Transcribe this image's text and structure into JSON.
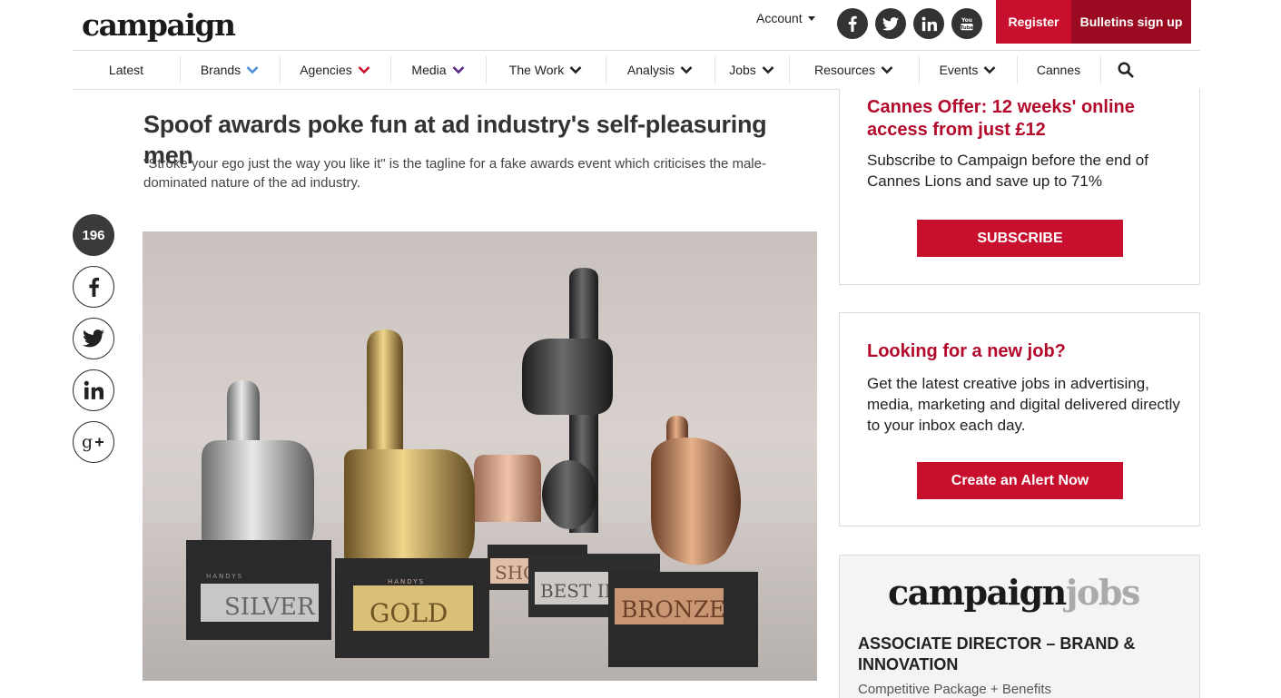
{
  "header": {
    "logo": "campaign",
    "account_label": "Account",
    "social": [
      "facebook-icon",
      "twitter-icon",
      "linkedin-icon",
      "youtube-icon"
    ],
    "register_label": "Register",
    "bulletins_label": "Bulletins sign up"
  },
  "nav": {
    "items": [
      {
        "label": "Latest",
        "chevron": ""
      },
      {
        "label": "Brands",
        "chevron": "#4a90d9"
      },
      {
        "label": "Agencies",
        "chevron": "#c8102e"
      },
      {
        "label": "Media",
        "chevron": "#5b2a86"
      },
      {
        "label": "The Work",
        "chevron": "#222222"
      },
      {
        "label": "Analysis",
        "chevron": "#222222"
      },
      {
        "label": "Jobs",
        "chevron": "#222222"
      },
      {
        "label": "Resources",
        "chevron": "#222222"
      },
      {
        "label": "Events",
        "chevron": "#222222"
      },
      {
        "label": "Cannes",
        "chevron": ""
      }
    ],
    "search_icon": "search-icon"
  },
  "article": {
    "headline": "Spoof awards poke fun at ad industry's self-pleasuring men",
    "standfirst": "\"Stroke your ego just the way you like it\" is the tagline for a fake awards event which criticises the male-dominated nature of the ad industry.",
    "share_count": "196",
    "share_icons": [
      "facebook-icon",
      "twitter-icon",
      "linkedin-icon",
      "google-plus-icon"
    ],
    "hero_plaques": {
      "brand": "HANDYS",
      "silver": "SILVER",
      "gold": "GOLD",
      "shortlist": "SHO",
      "best_in": "BEST IN",
      "bronze": "BRONZE"
    }
  },
  "sidebar": {
    "offer": {
      "title": "Cannes Offer: 12 weeks' online access from just £12",
      "text": "Subscribe to Campaign before the end of Cannes Lions and save up to 71%",
      "button": "SUBSCRIBE"
    },
    "job_alert": {
      "title": "Looking for a new job?",
      "text": "Get the latest creative jobs in advertising, media, marketing and digital delivered directly to your inbox each day.",
      "button": "Create an Alert Now"
    },
    "jobs": {
      "logo_main": "campaign",
      "logo_suffix": "jobs",
      "job_title": "ASSOCIATE DIRECTOR – BRAND & INNOVATION",
      "job_sub": "Competitive Package + Benefits"
    }
  },
  "colors": {
    "accent": "#c8102e",
    "accent_dark": "#9a0b22",
    "title_red": "#b3092a"
  }
}
